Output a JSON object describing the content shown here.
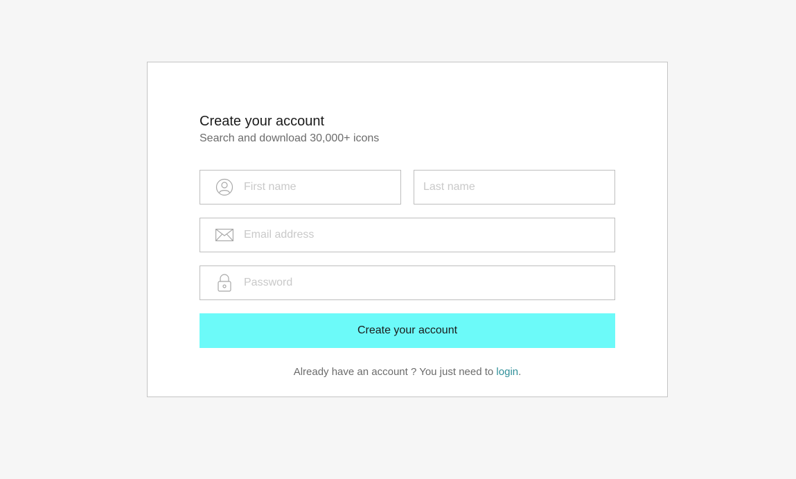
{
  "form": {
    "title": "Create your account",
    "subtitle": "Search and download 30,000+ icons",
    "first_name": {
      "placeholder": "First name",
      "icon": "user-icon"
    },
    "last_name": {
      "placeholder": "Last name"
    },
    "email": {
      "placeholder": "Email address",
      "icon": "mail-icon"
    },
    "password": {
      "placeholder": "Password",
      "icon": "lock-icon"
    },
    "submit_label": "Create your account",
    "footer_text": "Already have an account ? You just need to ",
    "login_link": "login",
    "footer_end": "."
  },
  "colors": {
    "accent": "#6cfaf9",
    "link": "#2f8f99",
    "background": "#f6f6f6"
  }
}
